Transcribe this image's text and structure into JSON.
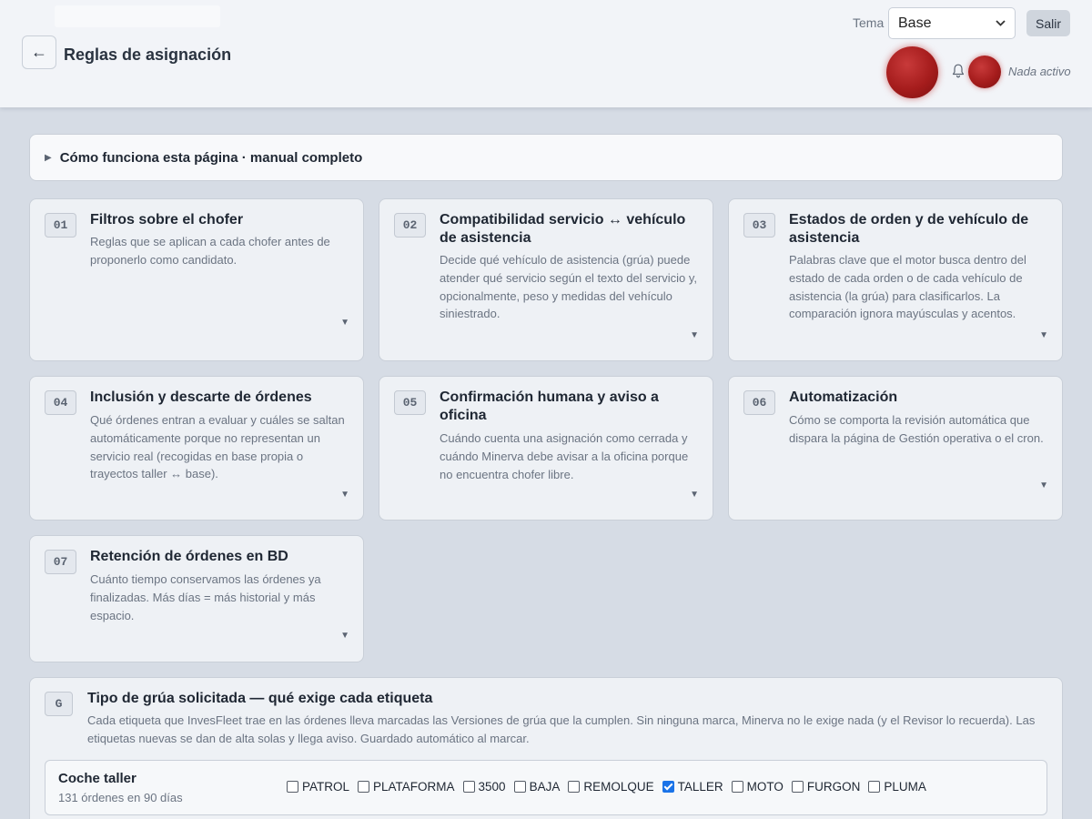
{
  "header": {
    "page_title": "Reglas de asignación",
    "back_icon": "←",
    "theme_label": "Tema",
    "theme_selected": "Base",
    "logout_label": "Salir",
    "status": "Nada activo"
  },
  "manual": {
    "toggle_icon": "▶",
    "label": "Cómo funciona esta página · manual completo"
  },
  "cards": [
    {
      "num": "01",
      "title": "Filtros sobre el chofer",
      "desc": "Reglas que se aplican a cada chofer antes de proponerlo como candidato."
    },
    {
      "num": "02",
      "title": "Compatibilidad servicio ↔ vehículo de asistencia",
      "desc": "Decide qué vehículo de asistencia (grúa) puede atender qué servicio según el texto del servicio y, opcionalmente, peso y medidas del vehículo siniestrado."
    },
    {
      "num": "03",
      "title": "Estados de orden y de vehículo de asistencia",
      "desc": "Palabras clave que el motor busca dentro del estado de cada orden o de cada vehículo de asistencia (la grúa) para clasificarlos. La comparación ignora mayúsculas y acentos."
    },
    {
      "num": "04",
      "title": "Inclusión y descarte de órdenes",
      "desc": "Qué órdenes entran a evaluar y cuáles se saltan automáticamente porque no representan un servicio real (recogidas en base propia o trayectos taller ↔ base)."
    },
    {
      "num": "05",
      "title": "Confirmación humana y aviso a oficina",
      "desc": "Cuándo cuenta una asignación como cerrada y cuándo Minerva debe avisar a la oficina porque no encuentra chofer libre."
    },
    {
      "num": "06",
      "title": "Automatización",
      "desc": "Cómo se comporta la revisión automática que dispara la página de Gestión operativa o el cron."
    },
    {
      "num": "07",
      "title": "Retención de órdenes en BD",
      "desc": "Cuánto tiempo conservamos las órdenes ya finalizadas. Más días = más historial y más espacio."
    }
  ],
  "card_chevron": "▼",
  "section_g": {
    "badge": "G",
    "title": "Tipo de grúa solicitada — qué exige cada etiqueta",
    "desc": "Cada etiqueta que InvesFleet trae en las órdenes lleva marcadas las Versiones de grúa que la cumplen. Sin ninguna marca, Minerva no le exige nada (y el Revisor lo recuerda). Las etiquetas nuevas se dan de alta solas y llega aviso. Guardado automático al marcar.",
    "row": {
      "title": "Coche taller",
      "subtitle": "131 órdenes en 90 días",
      "options": [
        {
          "label": "PATROL",
          "checked": false
        },
        {
          "label": "PLATAFORMA",
          "checked": false
        },
        {
          "label": "3500",
          "checked": false
        },
        {
          "label": "BAJA",
          "checked": false
        },
        {
          "label": "REMOLQUE",
          "checked": false
        },
        {
          "label": "TALLER",
          "checked": true
        },
        {
          "label": "MOTO",
          "checked": false
        },
        {
          "label": "FURGON",
          "checked": false
        },
        {
          "label": "PLUMA",
          "checked": false
        }
      ]
    }
  },
  "colors": {
    "background": "#d6dce5",
    "avatar_red": "#a51c1c",
    "checkbox_blue": "#1a73e8"
  }
}
